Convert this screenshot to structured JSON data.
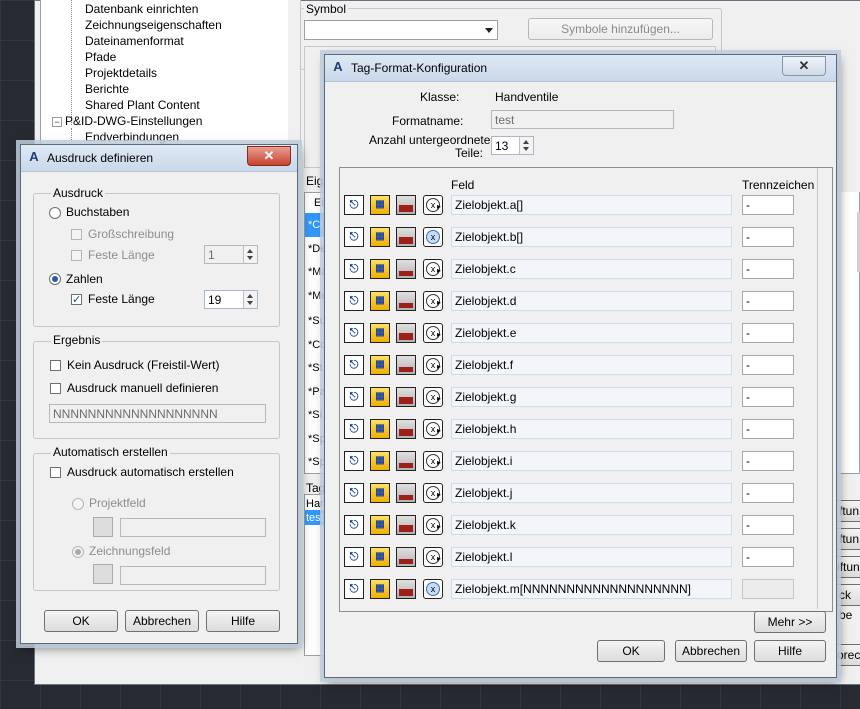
{
  "tree": {
    "items": [
      {
        "label": "Datenbank einrichten"
      },
      {
        "label": "Zeichnungseigenschaften"
      },
      {
        "label": "Dateinamenformat"
      },
      {
        "label": "Pfade"
      },
      {
        "label": "Projektdetails"
      },
      {
        "label": "Berichte"
      },
      {
        "label": "Shared Plant Content"
      },
      {
        "label": "P&ID-DWG-Einstellungen"
      },
      {
        "label": "Endverbindungen"
      }
    ],
    "expander_symbol": "−"
  },
  "symbol_panel": {
    "title": "Symbol",
    "combo_value": "",
    "add_symbols_button": "Symbole hinzufügen..."
  },
  "background": {
    "properties_label": "Eig",
    "list_header": "Ei",
    "list_rows": [
      "*Cl",
      "*De",
      "*Ma",
      "*Mo",
      "*Su",
      "*Co",
      "*St",
      "*Pa",
      "*Si",
      "*Sp",
      "*Sp"
    ],
    "tag_label": "Tag",
    "tag_rows": [
      "Han",
      "test"
    ],
    "right_buttons": [
      "ftun",
      "ftun",
      "iftun",
      "ck be",
      "orech"
    ]
  },
  "ausdruck": {
    "title": "Ausdruck definieren",
    "close_symbol": "✕",
    "group_ausdruck": "Ausdruck",
    "radio_buchstaben": "Buchstaben",
    "chk_grossschreibung": "Großschreibung",
    "chk_feste_laenge_1": "Feste Länge",
    "feste_laenge_1_value": "1",
    "radio_zahlen": "Zahlen",
    "chk_feste_laenge_2": "Feste Länge",
    "feste_laenge_2_value": "19",
    "check_mark": "✓",
    "group_ergebnis": "Ergebnis",
    "chk_kein_ausdruck": "Kein Ausdruck (Freistil-Wert)",
    "chk_manuell": "Ausdruck manuell definieren",
    "ergebnis_value": "NNNNNNNNNNNNNNNNNNN",
    "group_auto": "Automatisch erstellen",
    "chk_auto": "Ausdruck automatisch erstellen",
    "radio_projektfeld": "Projektfeld",
    "radio_zeichnungsfeld": "Zeichnungsfeld",
    "projektfeld_value": "",
    "zeichnungsfeld_value": "",
    "ok": "OK",
    "cancel": "Abbrechen",
    "help": "Hilfe"
  },
  "tagformat": {
    "title": "Tag-Format-Konfiguration",
    "close_symbol": "✕",
    "klasse_label": "Klasse:",
    "klasse_value": "Handventile",
    "formatname_label": "Formatname:",
    "formatname_value": "test",
    "anzahl_label_1": "Anzahl untergeordneter",
    "anzahl_label_2": "Teile:",
    "anzahl_value": "13",
    "col_feld": "Feld",
    "col_trenn": "Trennzeichen",
    "icon_prop": "⎋",
    "icon_folder": "▦",
    "icon_x": "x",
    "icon_tail": "▸",
    "rows": [
      {
        "field": "Zielobjekt.a[]",
        "sep": "-"
      },
      {
        "field": "Zielobjekt.b[]",
        "sep": "-"
      },
      {
        "field": "Zielobjekt.c",
        "sep": "-"
      },
      {
        "field": "Zielobjekt.d",
        "sep": "-"
      },
      {
        "field": "Zielobjekt.e",
        "sep": "-"
      },
      {
        "field": "Zielobjekt.f",
        "sep": "-"
      },
      {
        "field": "Zielobjekt.g",
        "sep": "-"
      },
      {
        "field": "Zielobjekt.h",
        "sep": "-"
      },
      {
        "field": "Zielobjekt.i",
        "sep": "-"
      },
      {
        "field": "Zielobjekt.j",
        "sep": "-"
      },
      {
        "field": "Zielobjekt.k",
        "sep": "-"
      },
      {
        "field": "Zielobjekt.l",
        "sep": "-"
      },
      {
        "field": "Zielobjekt.m[NNNNNNNNNNNNNNNNNNN]",
        "sep": ""
      }
    ],
    "more": "Mehr >>",
    "ok": "OK",
    "cancel": "Abbrechen",
    "help": "Hilfe"
  }
}
